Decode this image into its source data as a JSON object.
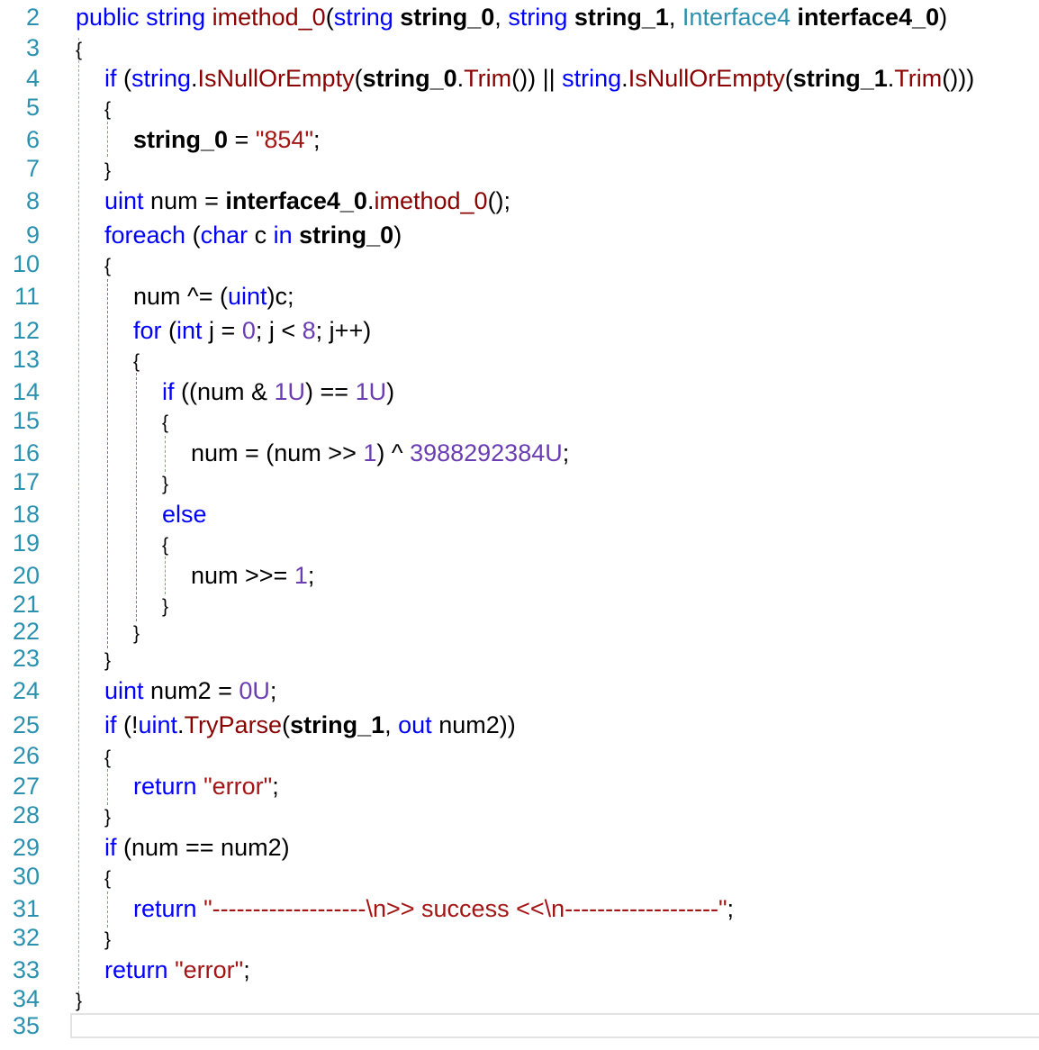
{
  "editor": {
    "lines": [
      {
        "n": "2",
        "indent": 0,
        "tokens": [
          [
            "kw",
            "public"
          ],
          [
            "p",
            " "
          ],
          [
            "kw",
            "string"
          ],
          [
            "p",
            " "
          ],
          [
            "rmeth",
            "imethod_0"
          ],
          [
            "p",
            "("
          ],
          [
            "kw",
            "string"
          ],
          [
            "p",
            " "
          ],
          [
            "param",
            "string_0"
          ],
          [
            "p",
            ", "
          ],
          [
            "kw",
            "string"
          ],
          [
            "p",
            " "
          ],
          [
            "param",
            "string_1"
          ],
          [
            "p",
            ", "
          ],
          [
            "type",
            "Interface4"
          ],
          [
            "p",
            " "
          ],
          [
            "param",
            "interface4_0"
          ],
          [
            "p",
            ")"
          ]
        ]
      },
      {
        "n": "3",
        "indent": 0,
        "tokens": [
          [
            "brace",
            "{"
          ]
        ]
      },
      {
        "n": "4",
        "indent": 1,
        "tokens": [
          [
            "kw",
            "if"
          ],
          [
            "p",
            " ("
          ],
          [
            "kw",
            "string"
          ],
          [
            "p",
            "."
          ],
          [
            "rmeth",
            "IsNullOrEmpty"
          ],
          [
            "p",
            "("
          ],
          [
            "param",
            "string_0"
          ],
          [
            "p",
            "."
          ],
          [
            "rmeth",
            "Trim"
          ],
          [
            "p",
            "()) || "
          ],
          [
            "kw",
            "string"
          ],
          [
            "p",
            "."
          ],
          [
            "rmeth",
            "IsNullOrEmpty"
          ],
          [
            "p",
            "("
          ],
          [
            "param",
            "string_1"
          ],
          [
            "p",
            "."
          ],
          [
            "rmeth",
            "Trim"
          ],
          [
            "p",
            "()))"
          ]
        ]
      },
      {
        "n": "5",
        "indent": 1,
        "tokens": [
          [
            "brace",
            "{"
          ]
        ]
      },
      {
        "n": "6",
        "indent": 2,
        "tokens": [
          [
            "param",
            "string_0"
          ],
          [
            "p",
            " = "
          ],
          [
            "str",
            "\"854\""
          ],
          [
            "p",
            ";"
          ]
        ]
      },
      {
        "n": "7",
        "indent": 1,
        "tokens": [
          [
            "brace",
            "}"
          ]
        ]
      },
      {
        "n": "8",
        "indent": 1,
        "tokens": [
          [
            "kw",
            "uint"
          ],
          [
            "p",
            " num = "
          ],
          [
            "param",
            "interface4_0"
          ],
          [
            "p",
            "."
          ],
          [
            "rmeth",
            "imethod_0"
          ],
          [
            "p",
            "();"
          ]
        ]
      },
      {
        "n": "9",
        "indent": 1,
        "tokens": [
          [
            "kw",
            "foreach"
          ],
          [
            "p",
            " ("
          ],
          [
            "kw",
            "char"
          ],
          [
            "p",
            " c "
          ],
          [
            "kw",
            "in"
          ],
          [
            "p",
            " "
          ],
          [
            "param",
            "string_0"
          ],
          [
            "p",
            ")"
          ]
        ]
      },
      {
        "n": "10",
        "indent": 1,
        "tokens": [
          [
            "brace",
            "{"
          ]
        ]
      },
      {
        "n": "11",
        "indent": 2,
        "tokens": [
          [
            "p",
            "num ^= ("
          ],
          [
            "kw",
            "uint"
          ],
          [
            "p",
            ")c;"
          ]
        ]
      },
      {
        "n": "12",
        "indent": 2,
        "tokens": [
          [
            "kw",
            "for"
          ],
          [
            "p",
            " ("
          ],
          [
            "kw",
            "int"
          ],
          [
            "p",
            " j = "
          ],
          [
            "num",
            "0"
          ],
          [
            "p",
            "; j < "
          ],
          [
            "num",
            "8"
          ],
          [
            "p",
            "; j++)"
          ]
        ]
      },
      {
        "n": "13",
        "indent": 2,
        "tokens": [
          [
            "brace",
            "{"
          ]
        ]
      },
      {
        "n": "14",
        "indent": 3,
        "tokens": [
          [
            "kw",
            "if"
          ],
          [
            "p",
            " ((num & "
          ],
          [
            "num",
            "1U"
          ],
          [
            "p",
            ") == "
          ],
          [
            "num",
            "1U"
          ],
          [
            "p",
            ")"
          ]
        ]
      },
      {
        "n": "15",
        "indent": 3,
        "tokens": [
          [
            "brace",
            "{"
          ]
        ]
      },
      {
        "n": "16",
        "indent": 4,
        "tokens": [
          [
            "p",
            "num = (num >> "
          ],
          [
            "num",
            "1"
          ],
          [
            "p",
            ") ^ "
          ],
          [
            "num",
            "3988292384U"
          ],
          [
            "p",
            ";"
          ]
        ]
      },
      {
        "n": "17",
        "indent": 3,
        "tokens": [
          [
            "brace",
            "}"
          ]
        ]
      },
      {
        "n": "18",
        "indent": 3,
        "tokens": [
          [
            "kw",
            "else"
          ]
        ]
      },
      {
        "n": "19",
        "indent": 3,
        "tokens": [
          [
            "brace",
            "{"
          ]
        ]
      },
      {
        "n": "20",
        "indent": 4,
        "tokens": [
          [
            "p",
            "num >>= "
          ],
          [
            "num",
            "1"
          ],
          [
            "p",
            ";"
          ]
        ]
      },
      {
        "n": "21",
        "indent": 3,
        "tokens": [
          [
            "brace",
            "}"
          ]
        ]
      },
      {
        "n": "22",
        "indent": 2,
        "tokens": [
          [
            "brace",
            "}"
          ]
        ]
      },
      {
        "n": "23",
        "indent": 1,
        "tokens": [
          [
            "brace",
            "}"
          ]
        ]
      },
      {
        "n": "24",
        "indent": 1,
        "tokens": [
          [
            "kw",
            "uint"
          ],
          [
            "p",
            " num2 = "
          ],
          [
            "num",
            "0U"
          ],
          [
            "p",
            ";"
          ]
        ]
      },
      {
        "n": "25",
        "indent": 1,
        "tokens": [
          [
            "kw",
            "if"
          ],
          [
            "p",
            " (!"
          ],
          [
            "kw",
            "uint"
          ],
          [
            "p",
            "."
          ],
          [
            "rmeth",
            "TryParse"
          ],
          [
            "p",
            "("
          ],
          [
            "param",
            "string_1"
          ],
          [
            "p",
            ", "
          ],
          [
            "kw",
            "out"
          ],
          [
            "p",
            " num2))"
          ]
        ]
      },
      {
        "n": "26",
        "indent": 1,
        "tokens": [
          [
            "brace",
            "{"
          ]
        ]
      },
      {
        "n": "27",
        "indent": 2,
        "tokens": [
          [
            "kw",
            "return"
          ],
          [
            "p",
            " "
          ],
          [
            "str",
            "\"error\""
          ],
          [
            "p",
            ";"
          ]
        ]
      },
      {
        "n": "28",
        "indent": 1,
        "tokens": [
          [
            "brace",
            "}"
          ]
        ]
      },
      {
        "n": "29",
        "indent": 1,
        "tokens": [
          [
            "kw",
            "if"
          ],
          [
            "p",
            " (num == num2)"
          ]
        ]
      },
      {
        "n": "30",
        "indent": 1,
        "tokens": [
          [
            "brace",
            "{"
          ]
        ]
      },
      {
        "n": "31",
        "indent": 2,
        "tokens": [
          [
            "kw",
            "return"
          ],
          [
            "p",
            " "
          ],
          [
            "str",
            "\"-------------------\\n>> success <<\\n-------------------\""
          ],
          [
            "p",
            ";"
          ]
        ]
      },
      {
        "n": "32",
        "indent": 1,
        "tokens": [
          [
            "brace",
            "}"
          ]
        ]
      },
      {
        "n": "33",
        "indent": 1,
        "tokens": [
          [
            "kw",
            "return"
          ],
          [
            "p",
            " "
          ],
          [
            "str",
            "\"error\""
          ],
          [
            "p",
            ";"
          ]
        ]
      },
      {
        "n": "34",
        "indent": 0,
        "tokens": [
          [
            "brace",
            "}"
          ]
        ]
      },
      {
        "n": "35",
        "indent": 0,
        "tokens": []
      }
    ]
  },
  "colors": {
    "keyword": "#0000ff",
    "type": "#2b91af",
    "method": "#8b0000",
    "string": "#a31515",
    "number": "#6a3db3",
    "line_number": "#2b91af"
  }
}
